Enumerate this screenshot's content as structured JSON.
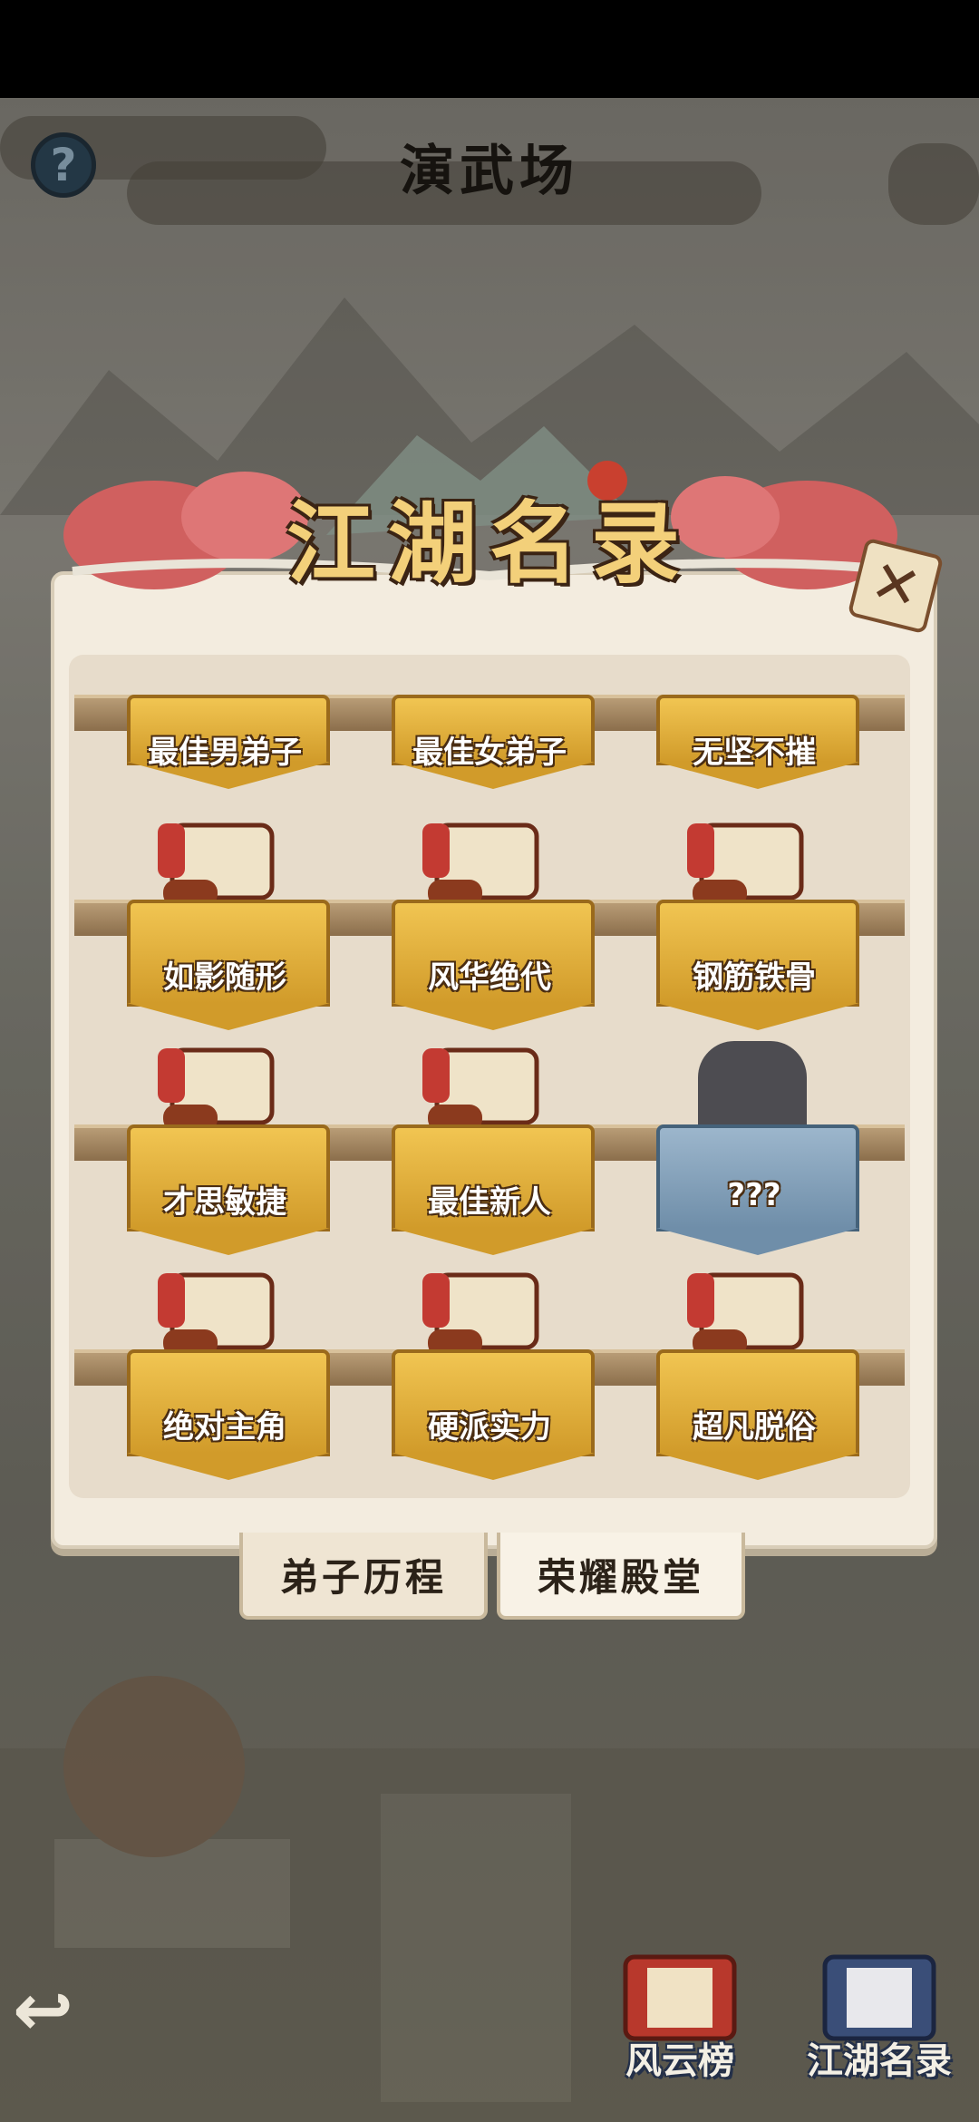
{
  "header": {
    "title": "演武场",
    "help_label": "?"
  },
  "dialog": {
    "banner_title": "江湖名录",
    "close_label": "✕",
    "rows": [
      {
        "items": [
          {
            "label": "最佳男弟子",
            "locked": false
          },
          {
            "label": "最佳女弟子",
            "locked": false
          },
          {
            "label": "无坚不摧",
            "locked": false
          }
        ]
      },
      {
        "items": [
          {
            "label": "如影随形",
            "locked": false
          },
          {
            "label": "风华绝代",
            "locked": false
          },
          {
            "label": "钢筋铁骨",
            "locked": false
          }
        ]
      },
      {
        "items": [
          {
            "label": "才思敏捷",
            "locked": false
          },
          {
            "label": "最佳新人",
            "locked": false
          },
          {
            "label": "???",
            "locked": true
          }
        ]
      },
      {
        "items": [
          {
            "label": "绝对主角",
            "locked": false
          },
          {
            "label": "硬派实力",
            "locked": false
          },
          {
            "label": "超凡脱俗",
            "locked": false
          }
        ]
      }
    ],
    "tabs": [
      {
        "label": "弟子历程"
      },
      {
        "label": "荣耀殿堂"
      }
    ]
  },
  "bottom": {
    "back_label": "↩",
    "buttons": [
      {
        "label": "风云榜",
        "icon": "book-red-icon"
      },
      {
        "label": "江湖名录",
        "icon": "book-blue-icon"
      }
    ]
  },
  "colors": {
    "gold": "#f1c552",
    "panel": "#f3ecdf",
    "locked": "#9cb6cc"
  }
}
